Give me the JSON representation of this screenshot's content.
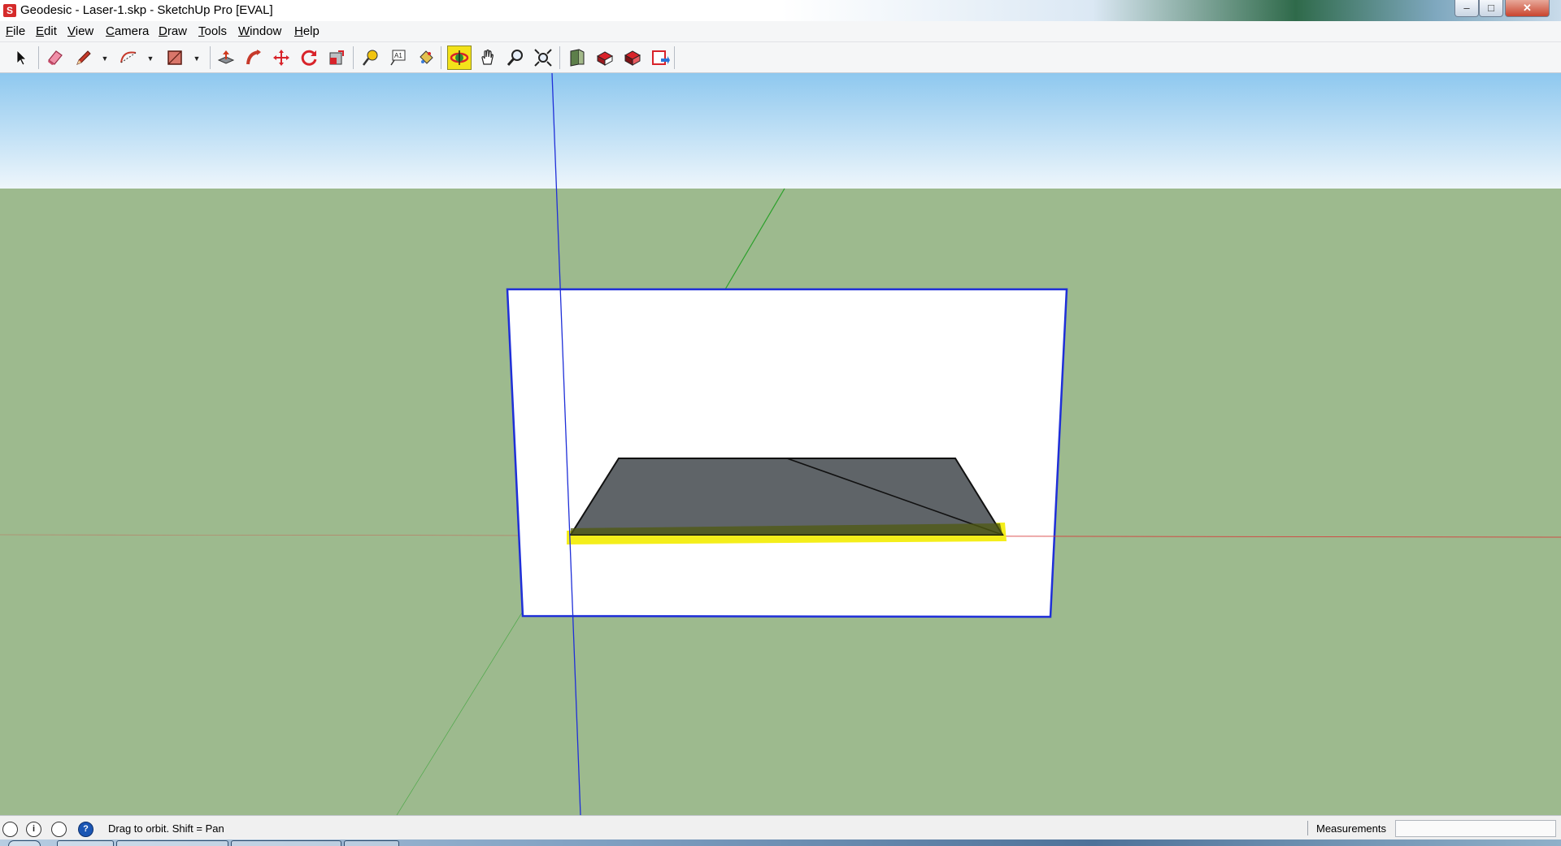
{
  "window": {
    "title": "Geodesic - Laser-1.skp - SketchUp Pro [EVAL]",
    "app_icon_glyph": "S",
    "controls": {
      "minimize": "–",
      "maximize": "□",
      "close": "✕"
    }
  },
  "menu": [
    {
      "ul": "F",
      "rest": "ile"
    },
    {
      "ul": "E",
      "rest": "dit"
    },
    {
      "ul": "V",
      "rest": "iew"
    },
    {
      "ul": "C",
      "rest": "amera"
    },
    {
      "ul": "D",
      "rest": "raw"
    },
    {
      "ul": "T",
      "rest": "ools"
    },
    {
      "ul": "W",
      "rest": "indow"
    },
    {
      "ul": "H",
      "rest": "elp"
    }
  ],
  "toolbar": {
    "tools": [
      "select",
      "eraser",
      "line",
      "arc",
      "rectangle",
      "push-pull",
      "follow-me",
      "move",
      "rotate",
      "scale",
      "tape-measure",
      "text",
      "paint-bucket",
      "orbit",
      "pan",
      "zoom",
      "zoom-extents",
      "previous-view",
      "components",
      "get-models",
      "share-model",
      "send-to-layout"
    ],
    "active_tool": "orbit"
  },
  "status": {
    "hint": "Drag to orbit.  Shift = Pan",
    "icons": [
      "geo-location",
      "credits",
      "user",
      "help"
    ],
    "help_glyph": "?",
    "info_glyph": "i",
    "measurements_label": "Measurements",
    "measurements_value": ""
  },
  "colors": {
    "sky_top": "#8ec8ef",
    "sky_bottom": "#eef6fb",
    "ground": "#9dba8e",
    "selection": "#f4ee1a",
    "face_gray": "#5f6468",
    "axis_red": "#d83a3a",
    "axis_green": "#2aa02a",
    "axis_blue": "#1f2fd8",
    "active_tool_bg": "#f3e21a"
  }
}
